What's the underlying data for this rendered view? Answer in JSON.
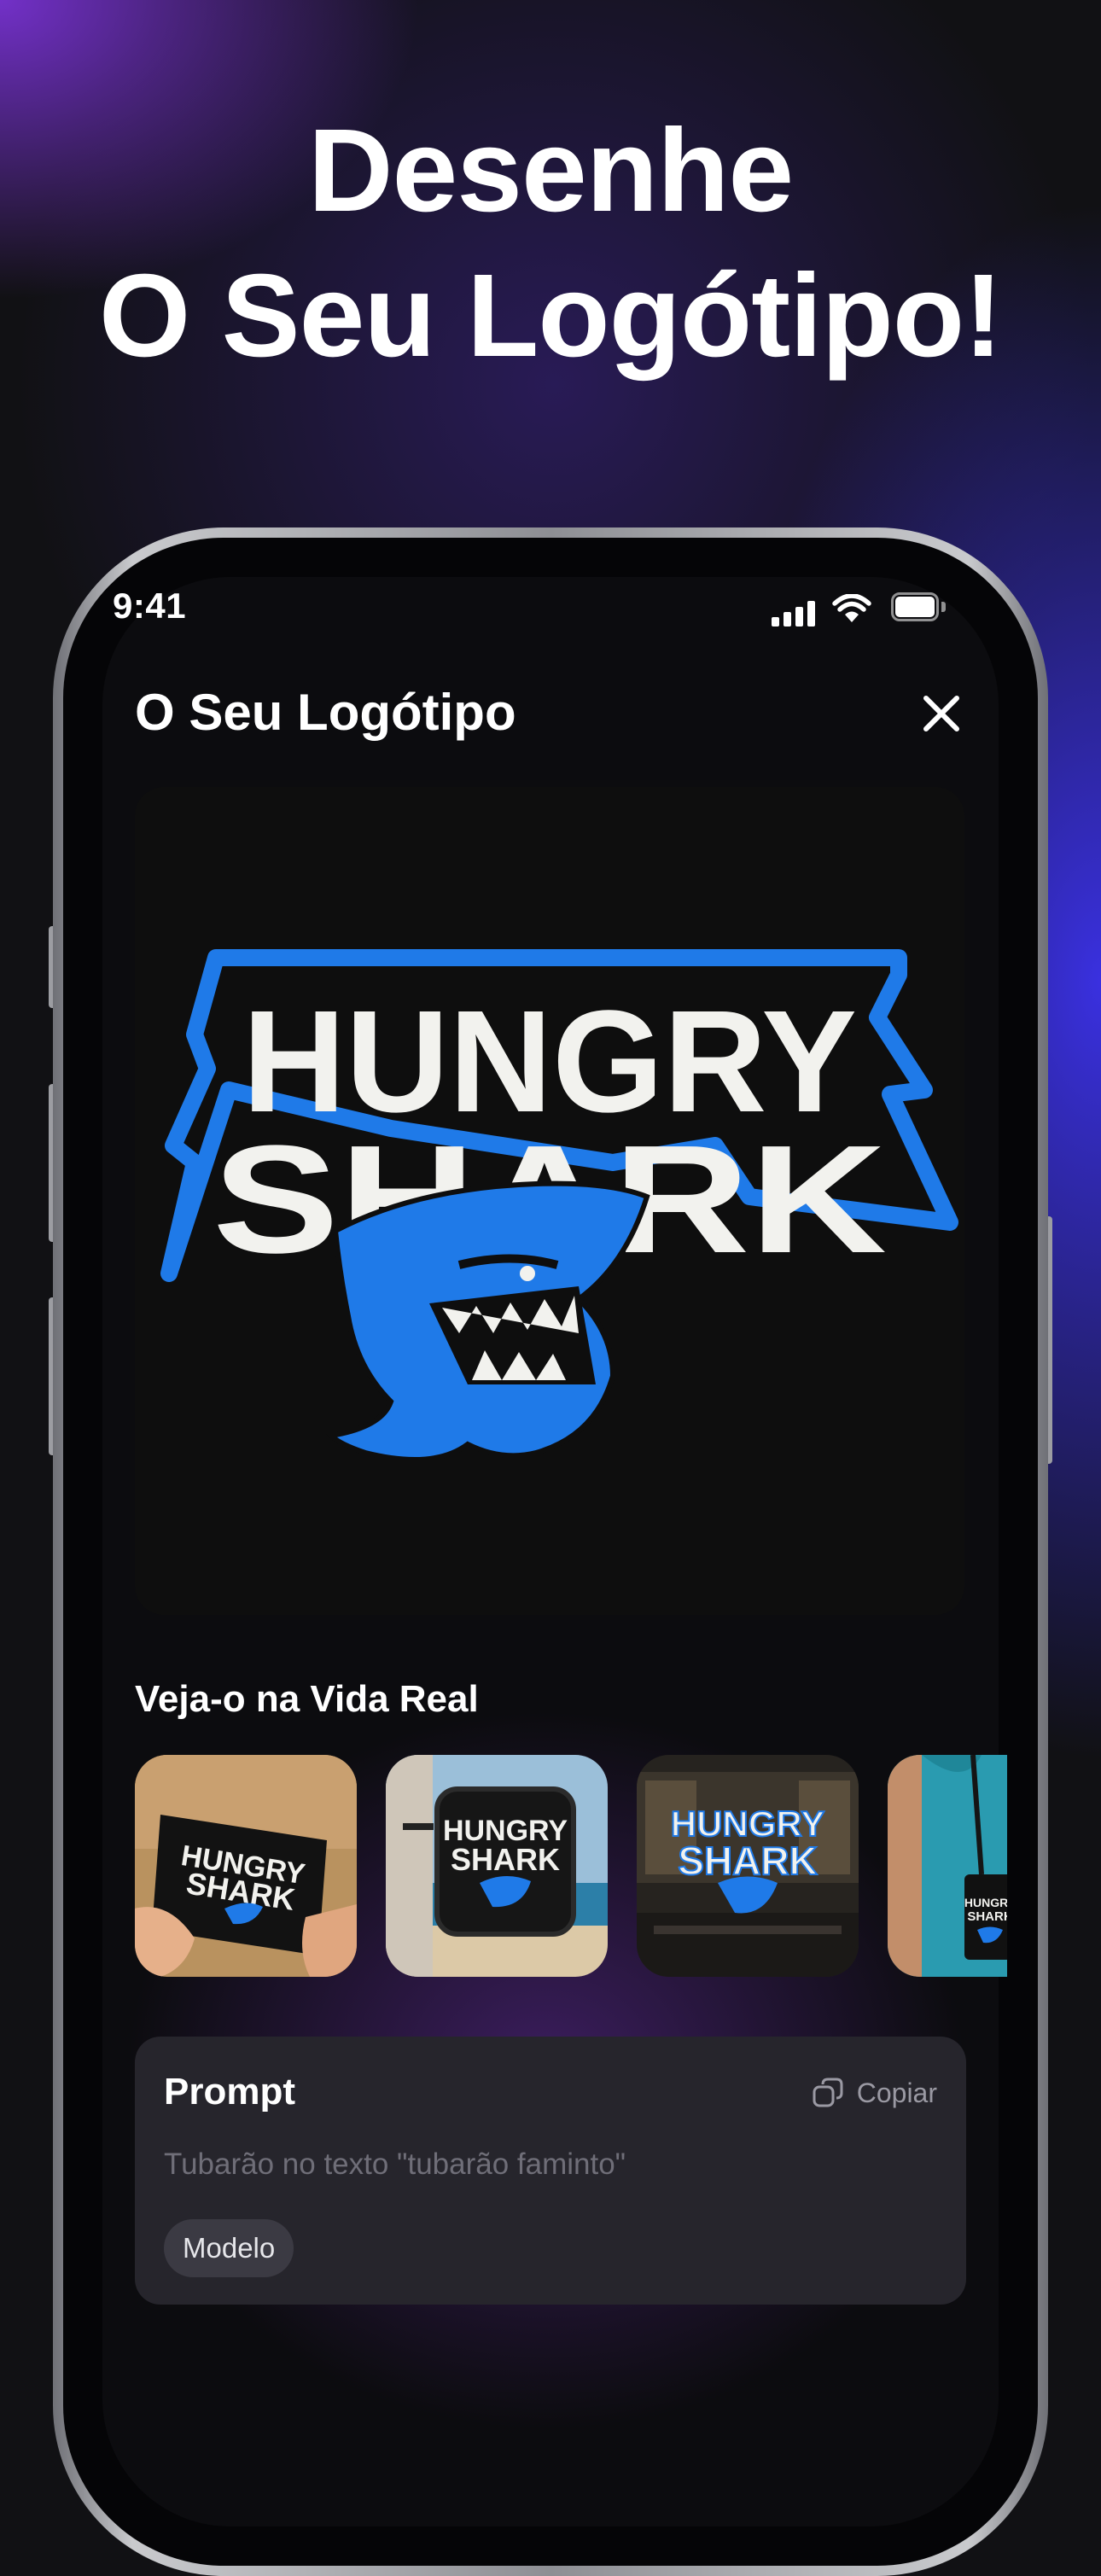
{
  "headline": {
    "line1": "Desenhe",
    "line2": "O Seu Logótipo!"
  },
  "status_bar": {
    "time": "9:41"
  },
  "screen": {
    "title": "O Seu Logótipo",
    "logo": {
      "line1": "HUNGRY",
      "line2": "SHARK",
      "colors": {
        "accent": "#1f7ae8",
        "text": "#f2f2ee",
        "background": "#0e0e0e"
      }
    },
    "real_life": {
      "title": "Veja-o na Vida Real",
      "thumbnails": [
        {
          "name": "business-card",
          "logo_line1": "HUNGRY",
          "logo_line2": "SHARK"
        },
        {
          "name": "store-sign",
          "logo_line1": "HUNGRY",
          "logo_line2": "SHARK"
        },
        {
          "name": "office-wall",
          "logo_line1": "HUNGRY",
          "logo_line2": "SHARK"
        },
        {
          "name": "lanyard-badge",
          "logo_line1": "HUNGRY",
          "logo_line2": "SHARK"
        }
      ]
    },
    "prompt": {
      "title": "Prompt",
      "copy_label": "Copiar",
      "text": "Tubarão no texto \"tubarão faminto\"",
      "chip_label": "Modelo"
    }
  }
}
